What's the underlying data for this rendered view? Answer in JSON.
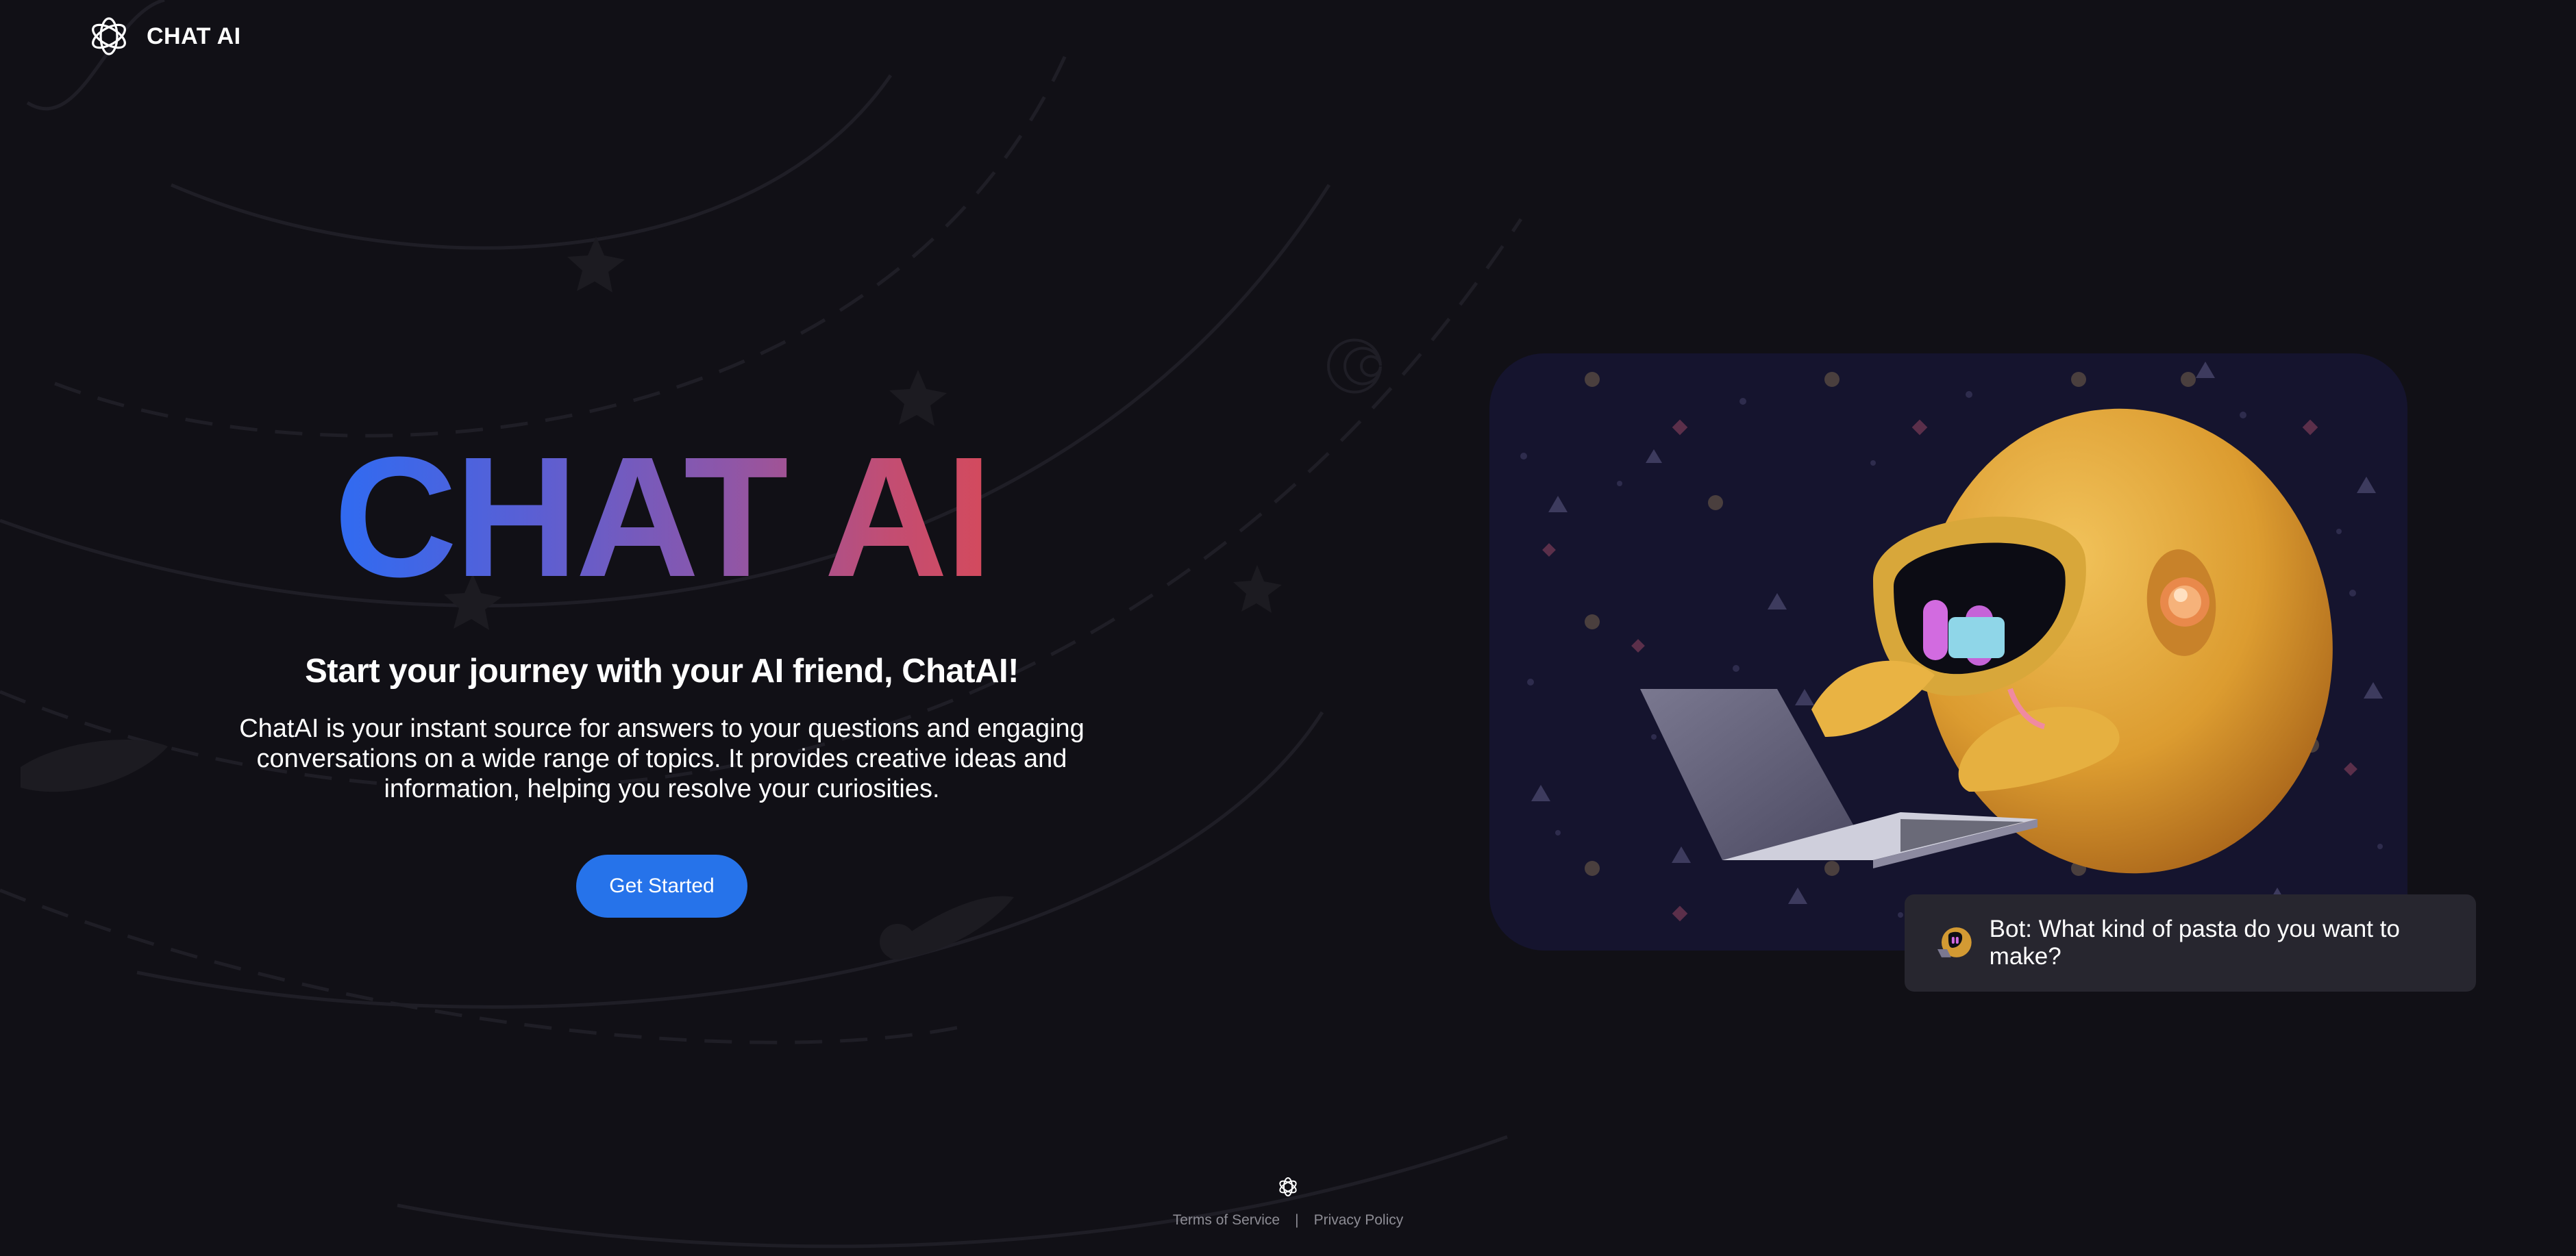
{
  "nav": {
    "brand": "CHAT AI"
  },
  "hero": {
    "title": "CHAT AI",
    "subtitle": "Start your journey with your AI friend, ChatAI!",
    "description": "ChatAI is your instant source for answers to your questions and engaging conversations on a wide range of topics. It provides creative ideas and information, helping you resolve your curiosities.",
    "cta_label": "Get Started"
  },
  "chat_preview": {
    "message": "Bot: What kind of pasta do you want to make?"
  },
  "footer": {
    "terms": "Terms of Service",
    "separator": "|",
    "privacy": "Privacy Policy"
  },
  "icons": {
    "brand_logo": "openai-knot-icon",
    "bot_avatar": "robot-avatar-icon",
    "footer_logo": "openai-knot-icon"
  },
  "colors": {
    "background": "#111016",
    "accent_button": "#2673ea",
    "title_gradient_start": "#2f6bf2",
    "title_gradient_end": "#d44a5c",
    "illustration_bg": "#15142e",
    "robot_body": "#e0a436",
    "chat_bubble_bg": "#27262f"
  }
}
